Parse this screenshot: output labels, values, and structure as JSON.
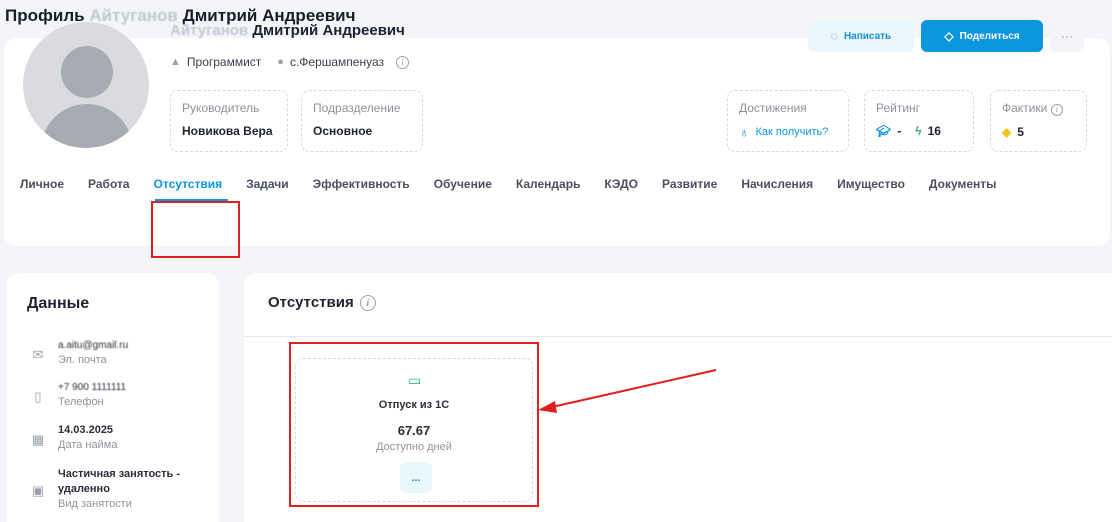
{
  "page": {
    "title_prefix": "Профиль",
    "title_blurred": "Айтуганов",
    "title_suffix": "Дмитрий Андреевич"
  },
  "profile": {
    "name_blurred": "Айтуганов",
    "name": "Дмитрий Андреевич",
    "position": "Программист",
    "location": "с.Фершампенуаз",
    "manager_label": "Руководитель",
    "manager_value": "Новикова Вера",
    "department_label": "Подразделение",
    "department_value": "Основное",
    "achievements_label": "Достижения",
    "achievements_link": "Как получить?",
    "rating_label": "Рейтинг",
    "rating_cap": "-",
    "rating_bolt": "16",
    "facts_label": "Фактики",
    "facts_value": "5"
  },
  "actions": {
    "write": "Написать",
    "share": "Поделиться",
    "more": "···"
  },
  "tabs": [
    {
      "label": "Личное"
    },
    {
      "label": "Работа"
    },
    {
      "label": "Отсутствия",
      "active": true
    },
    {
      "label": "Задачи"
    },
    {
      "label": "Эффективность"
    },
    {
      "label": "Обучение"
    },
    {
      "label": "Календарь"
    },
    {
      "label": "КЭДО"
    },
    {
      "label": "Развитие"
    },
    {
      "label": "Начисления"
    },
    {
      "label": "Имущество"
    },
    {
      "label": "Документы"
    }
  ],
  "data_panel": {
    "title": "Данные",
    "email_value": "a.aitu@gmail.ru",
    "email_label": "Эл. почта",
    "phone_value": "+7 900 1111111",
    "phone_label": "Телефон",
    "hire_value": "14.03.2025",
    "hire_label": "Дата найма",
    "employment_value_1": "Частичная занятость -",
    "employment_value_2": "удаленно",
    "employment_label": "Вид занятости"
  },
  "absences": {
    "title": "Отсутствия",
    "vacation_title": "Отпуск из 1С",
    "vacation_days": "67.67",
    "vacation_days_label": "Доступно дней",
    "vacation_more": "..."
  },
  "colors": {
    "accent": "#0b95de",
    "highlight": "#e02020",
    "success": "#2eb872"
  }
}
